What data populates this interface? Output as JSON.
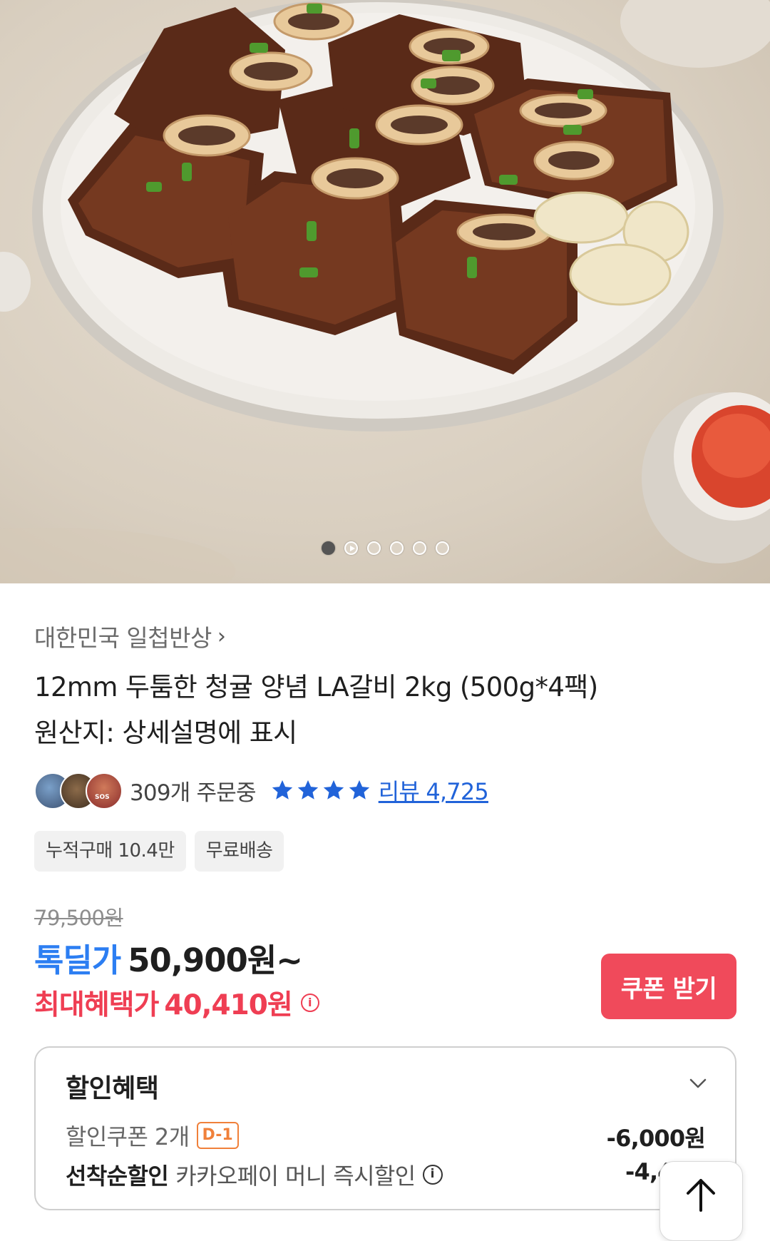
{
  "gallery": {
    "image_alt": "LA galbi on white ceramic plate with garlic and red seasoning",
    "dots": [
      "active",
      "play",
      "",
      "",
      "",
      ""
    ]
  },
  "product": {
    "brand": "대한민국 일첩반상",
    "title_line1": "12mm 두툼한 청귤 양념 LA갈비 2kg (500g*4팩)",
    "title_line2": "원산지: 상세설명에 표시",
    "orders_text": "309개 주문중",
    "rating_stars": 4,
    "review_label": "리뷰 4,725",
    "chips": [
      "누적구매 10.4만",
      "무료배송"
    ],
    "original_price": "79,500원",
    "deal_label": "톡딜가",
    "deal_price": "50,900원~",
    "max_label": "최대혜택가",
    "max_price": "40,410원",
    "coupon_button": "쿠폰 받기",
    "avatar_badge": "SOS"
  },
  "discount": {
    "title": "할인혜택",
    "coupon_label": "할인쿠폰 2개",
    "coupon_badge": "D-1",
    "coupon_amount": "-6,000원",
    "firstcome_label": "선착순할인",
    "firstcome_desc": "카카오페이 머니 즉시할인",
    "firstcome_amount": "-4,4"
  },
  "colors": {
    "deal_blue": "#2c7ef2",
    "benefit_red": "#ef3e53",
    "coupon_button_bg": "#f04a5b",
    "star_blue": "#2163d9",
    "badge_orange": "#f0803a"
  }
}
